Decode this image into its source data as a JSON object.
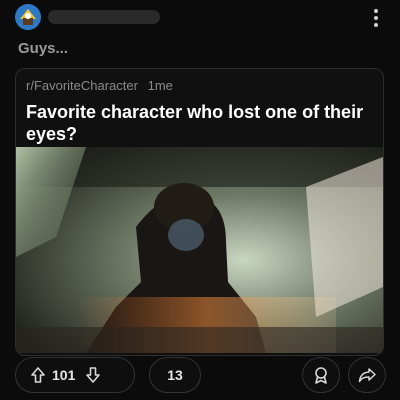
{
  "post": {
    "title": "Guys..."
  },
  "card": {
    "subreddit": "r/FavoriteCharacter",
    "age": "1me",
    "title": "Favorite character who lost one of their eyes?"
  },
  "actions": {
    "score": "101",
    "comments": "13"
  },
  "icons": {
    "avatar": "avatar",
    "menu": "kebab-menu-icon",
    "upvote": "arrow-up-icon",
    "downvote": "arrow-down-icon",
    "award": "award-icon",
    "share": "share-icon"
  },
  "colors": {
    "background": "#0b0b0b",
    "card_border": "#2e2e2e",
    "muted_text": "#9a9a9a",
    "title_text": "#ffffff"
  }
}
